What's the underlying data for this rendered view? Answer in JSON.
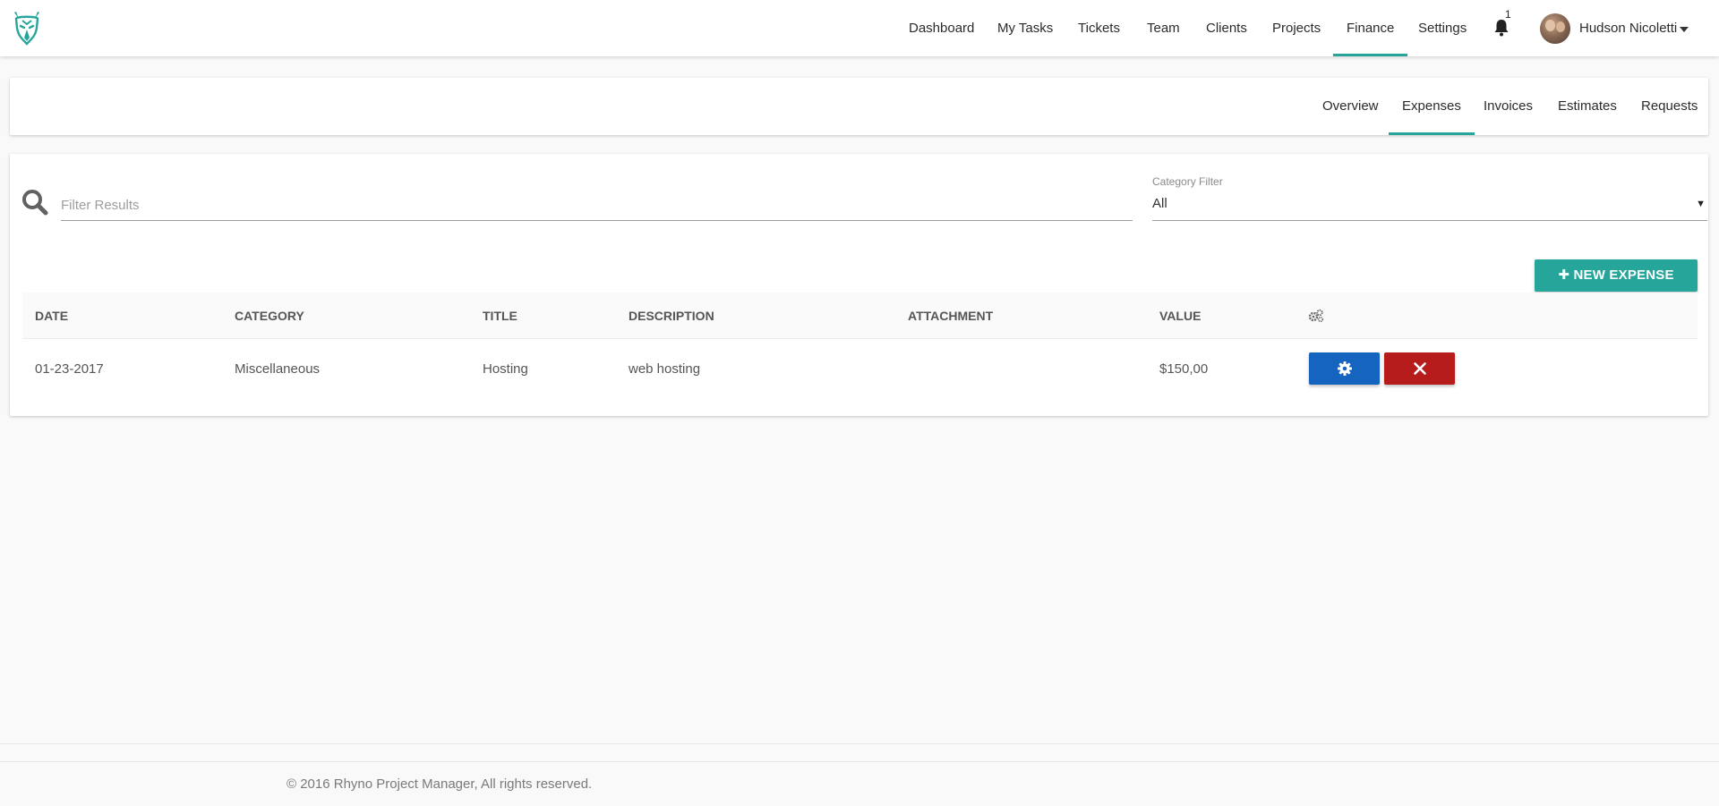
{
  "topnav": {
    "items": [
      {
        "label": "Dashboard"
      },
      {
        "label": "My Tasks"
      },
      {
        "label": "Tickets"
      },
      {
        "label": "Team"
      },
      {
        "label": "Clients"
      },
      {
        "label": "Projects"
      },
      {
        "label": "Finance",
        "active": true
      },
      {
        "label": "Settings"
      }
    ],
    "notification_count": "1",
    "user_name": "Hudson Nicoletti",
    "accent_color": "#26a69a"
  },
  "subnav": {
    "items": [
      {
        "label": "Overview"
      },
      {
        "label": "Expenses",
        "active": true
      },
      {
        "label": "Invoices"
      },
      {
        "label": "Estimates"
      },
      {
        "label": "Requests"
      }
    ]
  },
  "filters": {
    "search_placeholder": "Filter Results",
    "category_label": "Category Filter",
    "category_value": "All"
  },
  "actions": {
    "new_expense_label": "NEW EXPENSE"
  },
  "table": {
    "columns": [
      "DATE",
      "CATEGORY",
      "TITLE",
      "DESCRIPTION",
      "ATTACHMENT",
      "VALUE"
    ],
    "rows": [
      {
        "date": "01-23-2017",
        "category": "Miscellaneous",
        "title": "Hosting",
        "description": "web hosting",
        "attachment": "",
        "value": "$150,00"
      }
    ]
  },
  "colors": {
    "edit_button": "#1565c0",
    "delete_button": "#b71c1c",
    "new_button": "#26a69a"
  },
  "footer": {
    "copyright": "© 2016 Rhyno Project Manager, All rights reserved."
  }
}
